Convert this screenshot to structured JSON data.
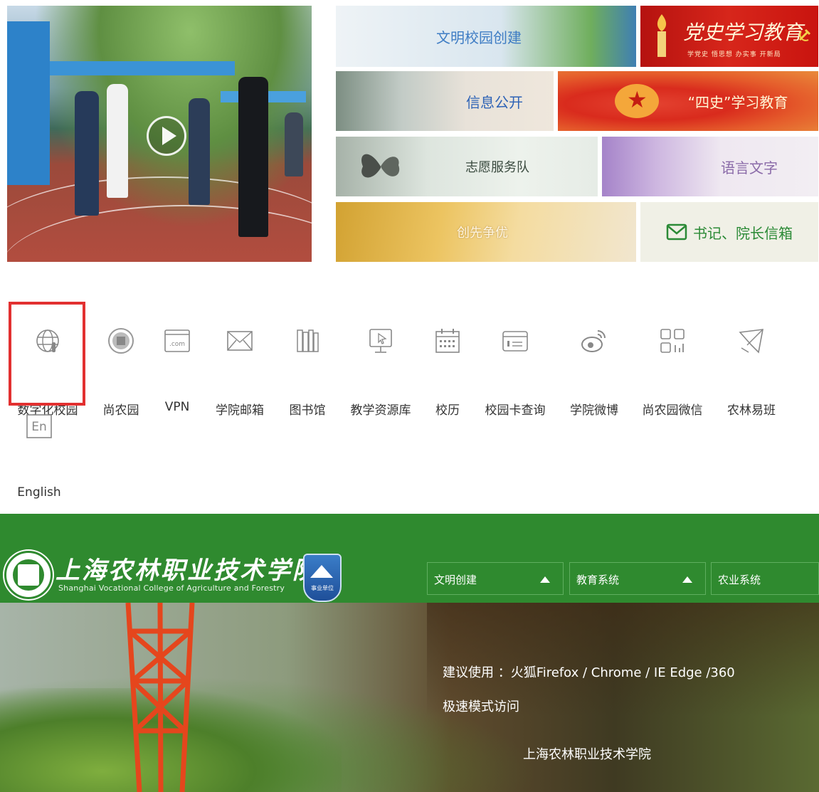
{
  "banners": {
    "civilized_campus": "文明校园创建",
    "party_history": "党史学习教育",
    "party_history_sub": "学党史 悟思想 办实事 开新局",
    "info_disclosure": "信息公开",
    "four_history": "“四史”学习教育",
    "volunteer": "志愿服务队",
    "language": "语言文字",
    "excellence": "创先争优",
    "mailbox": "书记、院长信箱"
  },
  "quick_links": [
    {
      "label": "数字化校园",
      "icon": "globe-icon"
    },
    {
      "label": "尚农园",
      "icon": "seal-icon"
    },
    {
      "label": "VPN",
      "icon": "com-screen-icon"
    },
    {
      "label": "学院邮箱",
      "icon": "envelope-icon"
    },
    {
      "label": "图书馆",
      "icon": "books-icon"
    },
    {
      "label": "教学资源库",
      "icon": "monitor-cursor-icon"
    },
    {
      "label": "校历",
      "icon": "calendar-icon"
    },
    {
      "label": "校园卡查询",
      "icon": "card-icon"
    },
    {
      "label": "学院微博",
      "icon": "weibo-icon"
    },
    {
      "label": "尚农园微信",
      "icon": "qr-icon"
    },
    {
      "label": "农林易班",
      "icon": "paper-plane-icon"
    },
    {
      "label": "English",
      "icon": "en-icon"
    }
  ],
  "footer": {
    "school_name_cn": "上海农林职业技术学院",
    "school_name_en": "Shanghai Vocational College of Agriculture and Forestry",
    "badge_text": "事业单位",
    "dropdowns": [
      "文明创建",
      "教育系统",
      "农业系统"
    ],
    "browser_tip_line1": "建议使用 ：火狐Firefox / Chrome / IE Edge /360",
    "browser_tip_line2": "极速模式访问",
    "footer_name": "上海农林职业技术学院"
  },
  "colors": {
    "footer_green": "#2f8a2f",
    "highlight_red": "#e23030",
    "banner_blue_text": "#3f7dc4"
  }
}
